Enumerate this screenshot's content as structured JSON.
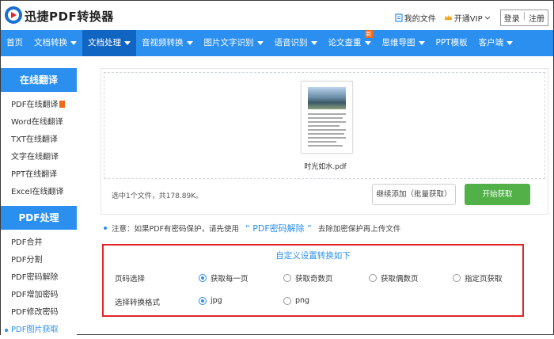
{
  "header": {
    "brand": "迅捷PDF转换器",
    "my_files": "我的文件",
    "vip": "开通VIP",
    "login": "登录",
    "register": "注册"
  },
  "nav": [
    {
      "label": "首页",
      "arrow": false
    },
    {
      "label": "文档转换",
      "arrow": true
    },
    {
      "label": "文档处理",
      "arrow": true,
      "active": true
    },
    {
      "label": "音视频转换",
      "arrow": true
    },
    {
      "label": "图片文字识别",
      "arrow": true
    },
    {
      "label": "语音识别",
      "arrow": true
    },
    {
      "label": "论文查重",
      "arrow": true,
      "badge": "新"
    },
    {
      "label": "思维导图",
      "arrow": true
    },
    {
      "label": "PPT模板",
      "arrow": false
    },
    {
      "label": "客户端",
      "arrow": true
    }
  ],
  "sidebar": {
    "section1": "在线翻译",
    "items1": [
      "PDF在线翻译",
      "Word在线翻译",
      "TXT在线翻译",
      "文字在线翻译",
      "PPT在线翻译",
      "Excel在线翻译"
    ],
    "section2": "PDF处理",
    "items2": [
      "PDF合并",
      "PDF分割",
      "PDF密码解除",
      "PDF增加密码",
      "PDF修改密码",
      "PDF图片获取"
    ]
  },
  "upload": {
    "filename": "时光如水.pdf",
    "info": "选中1个文件，共178.89K。",
    "add_button": "继续添加（批量获取）",
    "start_button": "开始获取"
  },
  "note": {
    "prefix": "注意：如果PDF有密码保护，请先使用",
    "link": "“ PDF密码解除 ”",
    "suffix": "去除加密保护再上传文件"
  },
  "settings": {
    "title": "自定义设置转换如下",
    "page_label": "页码选择",
    "page_options": [
      "获取每一页",
      "获取奇数页",
      "获取偶数页",
      "指定页获取"
    ],
    "page_selected": 0,
    "format_label": "选择转换格式",
    "format_options": [
      "jpg",
      "png"
    ],
    "format_selected": 0
  },
  "colors": {
    "accent": "#2b8ff0",
    "nav_active": "#1065c2",
    "start_green": "#51b148",
    "highlight_red": "#e0262b",
    "hot_orange": "#f06a1c"
  }
}
